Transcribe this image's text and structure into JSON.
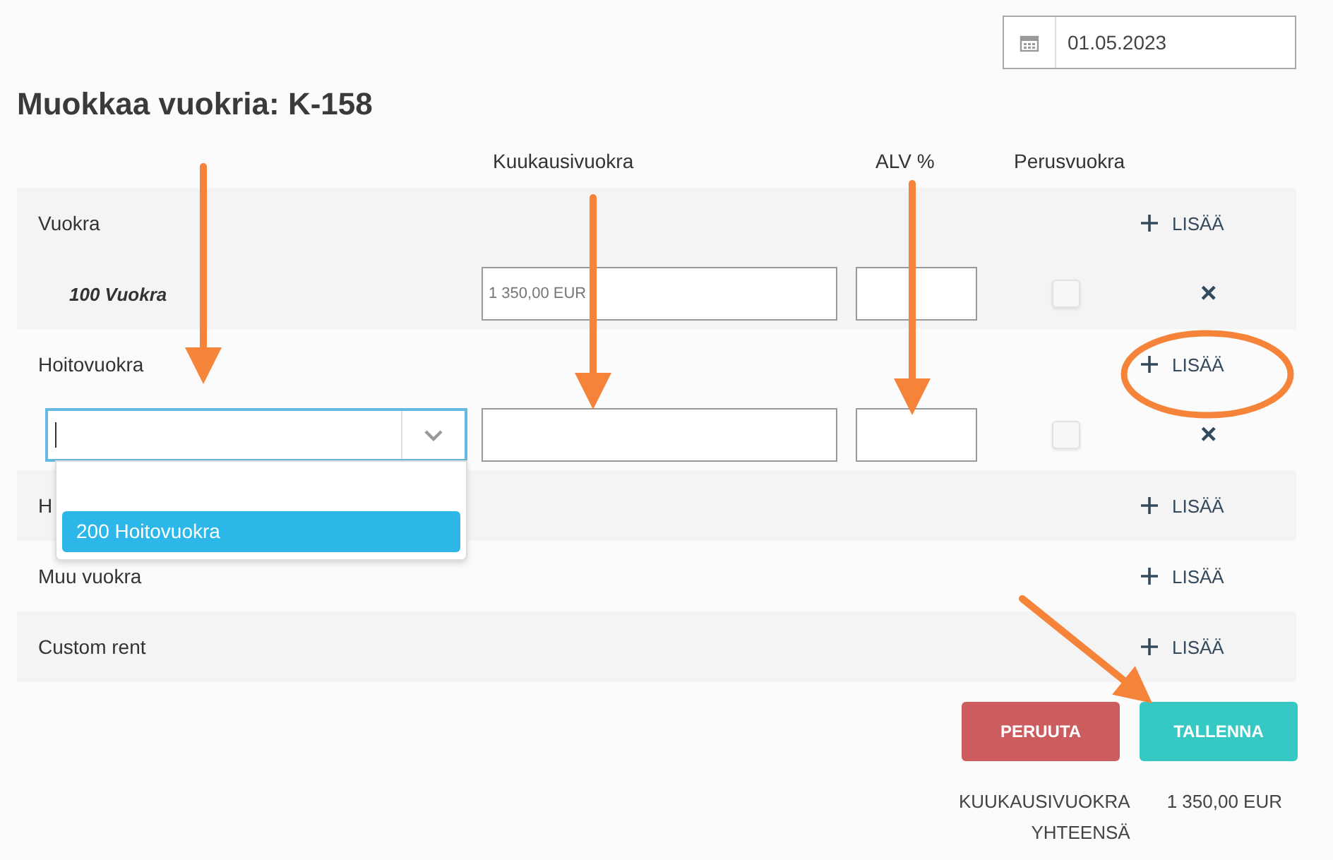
{
  "date_field": {
    "value": "01.05.2023"
  },
  "title": "Muokkaa vuokria: K-158",
  "columns": {
    "amount": "Kuukausivuokra",
    "vat": "ALV %",
    "basic": "Perusvuokra"
  },
  "categories": [
    {
      "name": "Vuokra",
      "add_label": "LISÄÄ",
      "rows": [
        {
          "kind": "item",
          "code": "100 Vuokra",
          "amount": "1 350,00 EUR",
          "vat": "",
          "basic": false,
          "remove": "×"
        }
      ]
    },
    {
      "name": "Hoitovuokra",
      "add_label": "LISÄÄ",
      "rows": [
        {
          "kind": "select",
          "amount": "",
          "vat": "",
          "basic": false,
          "remove": "×",
          "options": [
            {
              "label": "200 Hoitovuokra",
              "selected": true
            }
          ]
        }
      ]
    },
    {
      "name": "H",
      "add_label": "LISÄÄ"
    },
    {
      "name": "Muu vuokra",
      "add_label": "LISÄÄ"
    },
    {
      "name": "Custom rent",
      "add_label": "LISÄÄ"
    }
  ],
  "buttons": [
    {
      "kind": "cancel",
      "label": "PERUUTA"
    },
    {
      "kind": "save",
      "label": "TALLENNA"
    }
  ],
  "totals": [
    {
      "label": "KUUKAUSIVUOKRA YHTEENSÄ",
      "value": "1 350,00 EUR"
    }
  ],
  "annotations": [
    {
      "kind": "arrow"
    },
    {
      "kind": "arrow"
    },
    {
      "kind": "arrow"
    },
    {
      "kind": "ellipse"
    },
    {
      "kind": "arrow"
    }
  ]
}
